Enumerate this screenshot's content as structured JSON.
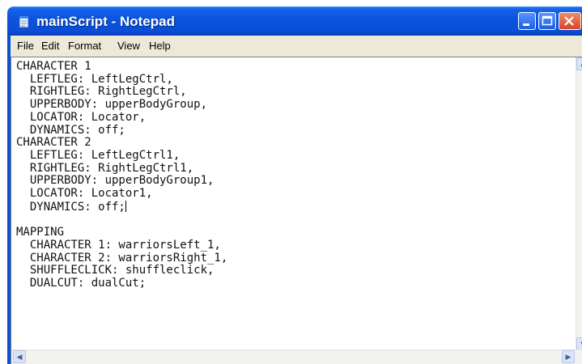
{
  "window": {
    "title": "mainScript - Notepad"
  },
  "menu": {
    "items": [
      "File",
      "Edit",
      "Format",
      "View",
      "Help"
    ]
  },
  "document": {
    "lines": [
      "CHARACTER 1",
      "  LEFTLEG: LeftLegCtrl,",
      "  RIGHTLEG: RightLegCtrl,",
      "  UPPERBODY: upperBodyGroup,",
      "  LOCATOR: Locator,",
      "  DYNAMICS: off;",
      "CHARACTER 2",
      "  LEFTLEG: LeftLegCtrl1,",
      "  RIGHTLEG: RightLegCtrl1,",
      "  UPPERBODY: upperBodyGroup1,",
      "  LOCATOR: Locator1,",
      "  DYNAMICS: off;",
      "",
      "MAPPING",
      "  CHARACTER 1: warriorsLeft_1,",
      "  CHARACTER 2: warriorsRight_1,",
      "  SHUFFLECLICK: shuffleclick,",
      "  DUALCUT: dualCut;"
    ],
    "caret_line_index": 11
  },
  "colors": {
    "titlebar": "#0a4fd8",
    "menubar": "#ece9d8",
    "editor_bg": "#ffffff"
  }
}
